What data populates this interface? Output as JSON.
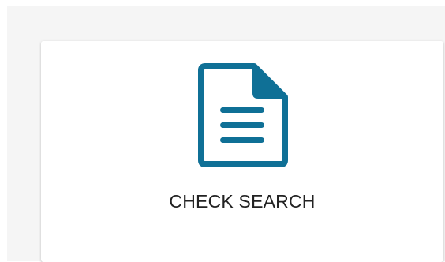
{
  "card": {
    "label": "CHECK SEARCH",
    "icon": "document-icon",
    "icon_color": "#0f7096"
  },
  "colors": {
    "panel_background": "#f5f5f5",
    "card_background": "#ffffff",
    "label_color": "#222222"
  }
}
